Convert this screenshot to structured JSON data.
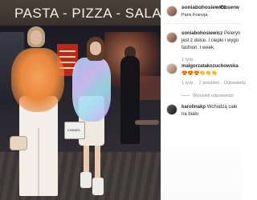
{
  "photo": {
    "sign_text": "PASTA - PIZZA - SALADE - AN",
    "bag_logo": "CHANEL"
  },
  "post_header": {
    "username": "soniabohosiewicz",
    "separator": "•",
    "follow_label": "Obserw",
    "location": "Paris Francja"
  },
  "caption": {
    "username": "soniabohosiewicz",
    "text": "Peleryn jest z dolce. I ciepło i wygo fashion. I week.",
    "time": "1 tydz."
  },
  "comments": [
    {
      "username": "malgorzatakozuchowska",
      "text": "😍😍😍👏👏👏",
      "time": "1 tydz.",
      "likes": "2 polubień",
      "reply_label": "Odpowiedz"
    },
    {
      "username": "karolinakp",
      "text": "Wchodzą całe na biało"
    }
  ],
  "view_replies": "Wyświetl odpowiedzi",
  "colors": {
    "text": "#262626",
    "meta": "#8e8e8e",
    "orange_tulle": "#e9873d"
  }
}
